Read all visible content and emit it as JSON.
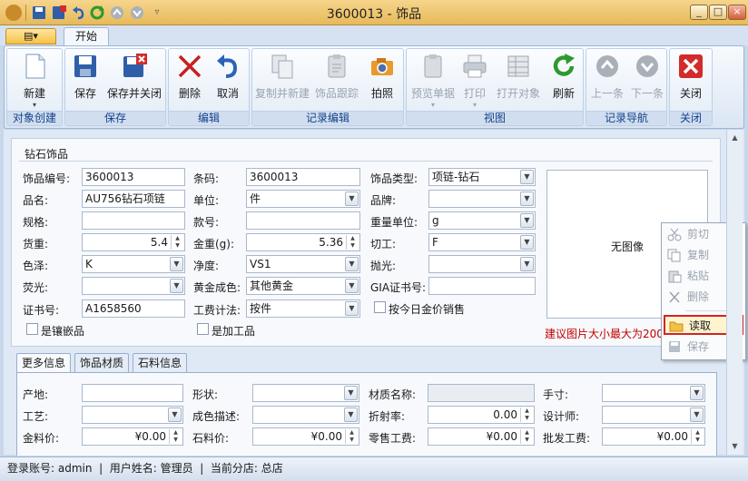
{
  "window": {
    "title": "3600013 - 饰品",
    "minimize": "_",
    "maximize": "□",
    "close": "×"
  },
  "app_menu": {
    "label": "▤▾"
  },
  "tabs": {
    "home": "开始"
  },
  "ribbon": {
    "groups": {
      "create": "对象创建",
      "save": "保存",
      "edit": "编辑",
      "record_edit": "记录编辑",
      "view": "视图",
      "nav": "记录导航",
      "close": "关闭"
    },
    "buttons": {
      "new": "新建",
      "save": "保存",
      "save_close": "保存并关闭",
      "delete": "删除",
      "cancel": "取消",
      "copy_new": "复制并新建",
      "jewelry_track": "饰品跟踪",
      "photo": "拍照",
      "preview": "预览单据",
      "print": "打印",
      "print_obj": "打开对象",
      "refresh": "刷新",
      "prev": "上一条",
      "next": "下一条",
      "close": "关闭"
    }
  },
  "panel": {
    "title": "钻石饰品"
  },
  "form": {
    "code_label": "饰品编号:",
    "code": "3600013",
    "barcode_label": "条码:",
    "barcode": "3600013",
    "type_label": "饰品类型:",
    "type": "项链-钻石",
    "name_label": "品名:",
    "name": "AU756钻石项链",
    "unit_label": "单位:",
    "unit": "件",
    "brand_label": "品牌:",
    "brand": "",
    "spec_label": "规格:",
    "spec": "",
    "style_label": "款号:",
    "style": "",
    "weight_unit_label": "重量单位:",
    "weight_unit": "g",
    "goods_weight_label": "货重:",
    "goods_weight": "5.4",
    "gold_weight_label": "金重(g):",
    "gold_weight": "5.36",
    "cut_label": "切工:",
    "cut": "F",
    "color_label": "色泽:",
    "color": "K",
    "clarity_label": "净度:",
    "clarity": "VS1",
    "polish_label": "抛光:",
    "polish": "",
    "fluor_label": "荧光:",
    "fluor": "",
    "gold_color_label": "黄金成色:",
    "gold_color": "其他黄金",
    "gia_label": "GIA证书号:",
    "gia": "",
    "cert_label": "证书号:",
    "cert": "A1658560",
    "labor_label": "工费计法:",
    "labor": "按件",
    "today_price_label": "按今日金价销售",
    "inlay_label": "是镶嵌品",
    "processed_label": "是加工品"
  },
  "image": {
    "empty": "无图像",
    "hint": "建议图片大小最大为200"
  },
  "context_menu": {
    "cut": "剪切",
    "copy": "复制",
    "paste": "粘贴",
    "delete": "删除",
    "read": "读取",
    "save": "保存"
  },
  "subtabs": {
    "more": "更多信息",
    "material": "饰品材质",
    "stone": "石料信息"
  },
  "more": {
    "origin_label": "产地:",
    "origin": "",
    "shape_label": "形状:",
    "shape": "",
    "material_name_label": "材质名称:",
    "material_name": "",
    "size_label": "手寸:",
    "size": "",
    "craft_label": "工艺:",
    "craft": "",
    "finish_label": "成色描述:",
    "finish": "",
    "refr_label": "折射率:",
    "refr": "0.00",
    "designer_label": "设计师:",
    "designer": "",
    "gold_price_label": "金料价:",
    "gold_price": "¥0.00",
    "stone_price_label": "石料价:",
    "stone_price": "¥0.00",
    "retail_labor_label": "零售工费:",
    "retail_labor": "¥0.00",
    "wholesale_labor_label": "批发工费:",
    "wholesale_labor": "¥0.00"
  },
  "status": {
    "text": "登录账号: admin  |  用户姓名: 管理员  |  当前分店: 总店"
  }
}
